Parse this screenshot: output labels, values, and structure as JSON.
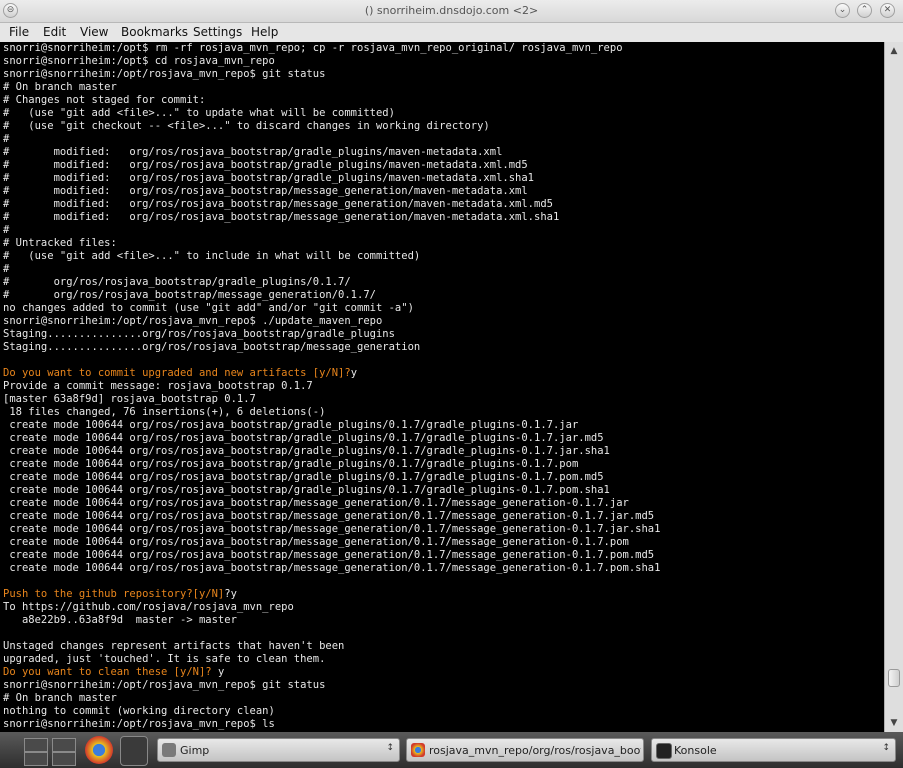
{
  "window": {
    "title": "() snorriheim.dnsdojo.com <2>",
    "buttons": [
      "⌄",
      "⌃",
      "✕"
    ]
  },
  "menu": [
    "File",
    "Edit",
    "View",
    "Bookmarks",
    "Settings",
    "Help"
  ],
  "terminal": {
    "lines": [
      {
        "text": "snorri@snorriheim:/opt$ rm -rf rosjava_mvn_repo; cp -r rosjava_mvn_repo_original/ rosjava_mvn_repo"
      },
      {
        "text": "snorri@snorriheim:/opt$ cd rosjava_mvn_repo"
      },
      {
        "text": "snorri@snorriheim:/opt/rosjava_mvn_repo$ git status"
      },
      {
        "text": "# On branch master"
      },
      {
        "text": "# Changes not staged for commit:"
      },
      {
        "text": "#   (use \"git add <file>...\" to update what will be committed)"
      },
      {
        "text": "#   (use \"git checkout -- <file>...\" to discard changes in working directory)"
      },
      {
        "text": "#"
      },
      {
        "text": "#       modified:   org/ros/rosjava_bootstrap/gradle_plugins/maven-metadata.xml"
      },
      {
        "text": "#       modified:   org/ros/rosjava_bootstrap/gradle_plugins/maven-metadata.xml.md5"
      },
      {
        "text": "#       modified:   org/ros/rosjava_bootstrap/gradle_plugins/maven-metadata.xml.sha1"
      },
      {
        "text": "#       modified:   org/ros/rosjava_bootstrap/message_generation/maven-metadata.xml"
      },
      {
        "text": "#       modified:   org/ros/rosjava_bootstrap/message_generation/maven-metadata.xml.md5"
      },
      {
        "text": "#       modified:   org/ros/rosjava_bootstrap/message_generation/maven-metadata.xml.sha1"
      },
      {
        "text": "#"
      },
      {
        "text": "# Untracked files:"
      },
      {
        "text": "#   (use \"git add <file>...\" to include in what will be committed)"
      },
      {
        "text": "#"
      },
      {
        "text": "#       org/ros/rosjava_bootstrap/gradle_plugins/0.1.7/"
      },
      {
        "text": "#       org/ros/rosjava_bootstrap/message_generation/0.1.7/"
      },
      {
        "text": "no changes added to commit (use \"git add\" and/or \"git commit -a\")"
      },
      {
        "text": "snorri@snorriheim:/opt/rosjava_mvn_repo$ ./update_maven_repo"
      },
      {
        "text": "Staging...............org/ros/rosjava_bootstrap/gradle_plugins"
      },
      {
        "text": "Staging...............org/ros/rosjava_bootstrap/message_generation"
      },
      {
        "text": ""
      },
      {
        "text": "Do you want to commit upgraded and new artifacts [y/N]?",
        "orange": true,
        "suffix": "y"
      },
      {
        "text": "Provide a commit message: rosjava_bootstrap 0.1.7"
      },
      {
        "text": "[master 63a8f9d] rosjava_bootstrap 0.1.7"
      },
      {
        "text": " 18 files changed, 76 insertions(+), 6 deletions(-)"
      },
      {
        "text": " create mode 100644 org/ros/rosjava_bootstrap/gradle_plugins/0.1.7/gradle_plugins-0.1.7.jar"
      },
      {
        "text": " create mode 100644 org/ros/rosjava_bootstrap/gradle_plugins/0.1.7/gradle_plugins-0.1.7.jar.md5"
      },
      {
        "text": " create mode 100644 org/ros/rosjava_bootstrap/gradle_plugins/0.1.7/gradle_plugins-0.1.7.jar.sha1"
      },
      {
        "text": " create mode 100644 org/ros/rosjava_bootstrap/gradle_plugins/0.1.7/gradle_plugins-0.1.7.pom"
      },
      {
        "text": " create mode 100644 org/ros/rosjava_bootstrap/gradle_plugins/0.1.7/gradle_plugins-0.1.7.pom.md5"
      },
      {
        "text": " create mode 100644 org/ros/rosjava_bootstrap/gradle_plugins/0.1.7/gradle_plugins-0.1.7.pom.sha1"
      },
      {
        "text": " create mode 100644 org/ros/rosjava_bootstrap/message_generation/0.1.7/message_generation-0.1.7.jar"
      },
      {
        "text": " create mode 100644 org/ros/rosjava_bootstrap/message_generation/0.1.7/message_generation-0.1.7.jar.md5"
      },
      {
        "text": " create mode 100644 org/ros/rosjava_bootstrap/message_generation/0.1.7/message_generation-0.1.7.jar.sha1"
      },
      {
        "text": " create mode 100644 org/ros/rosjava_bootstrap/message_generation/0.1.7/message_generation-0.1.7.pom"
      },
      {
        "text": " create mode 100644 org/ros/rosjava_bootstrap/message_generation/0.1.7/message_generation-0.1.7.pom.md5"
      },
      {
        "text": " create mode 100644 org/ros/rosjava_bootstrap/message_generation/0.1.7/message_generation-0.1.7.pom.sha1"
      },
      {
        "text": ""
      },
      {
        "text": "Push to the github repository?[y/N]",
        "orange": true,
        "suffix": "?y"
      },
      {
        "text": "To https://github.com/rosjava/rosjava_mvn_repo"
      },
      {
        "text": "   a8e22b9..63a8f9d  master -> master"
      },
      {
        "text": ""
      },
      {
        "text": "Unstaged changes represent artifacts that haven't been"
      },
      {
        "text": "upgraded, just 'touched'. It is safe to clean them."
      },
      {
        "text": "Do you want to clean these [y/N]?",
        "orange": true,
        "suffix": " y"
      },
      {
        "text": "snorri@snorriheim:/opt/rosjava_mvn_repo$ git status"
      },
      {
        "text": "# On branch master"
      },
      {
        "text": "nothing to commit (working directory clean)"
      },
      {
        "text": "snorri@snorriheim:/opt/rosjava_mvn_repo$ ls"
      }
    ]
  },
  "taskbar": {
    "tasks": [
      {
        "label": "Gimp",
        "icon_color": "#7a7a7a",
        "icon": "gimp-icon"
      },
      {
        "label": "rosjava_mvn_repo/org/ros/rosjava_bootstra",
        "icon_color": "#3b7ddd",
        "icon": "chrome-icon"
      },
      {
        "label": "Konsole",
        "icon_color": "#222222",
        "icon": "konsole-icon"
      }
    ],
    "arrow": "↕"
  },
  "colors": {
    "prompt_orange": "#e8851c",
    "terminal_fg": "#e8e8e8",
    "terminal_bg": "#000000"
  }
}
